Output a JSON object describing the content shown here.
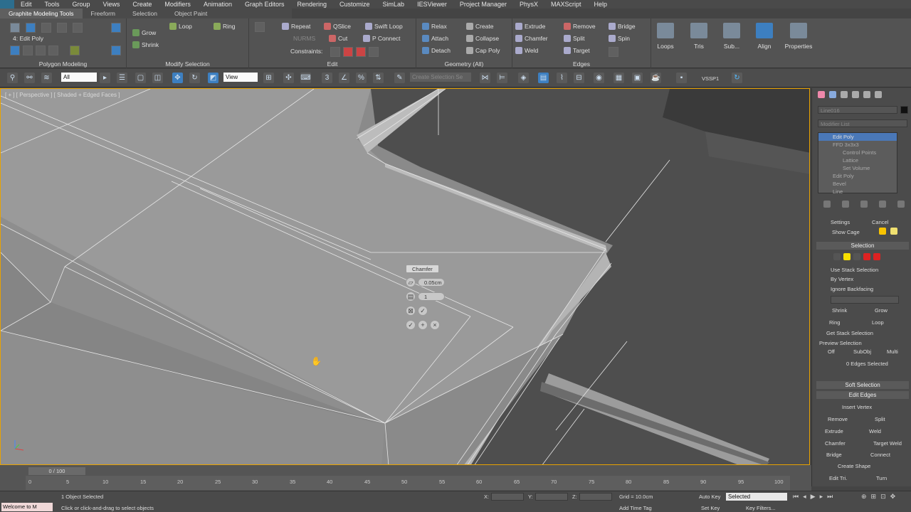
{
  "menu": [
    "Edit",
    "Tools",
    "Group",
    "Views",
    "Create",
    "Modifiers",
    "Animation",
    "Graph Editors",
    "Rendering",
    "Customize",
    "SimLab",
    "IESViewer",
    "Project Manager",
    "PhysX",
    "MAXScript",
    "Help"
  ],
  "graphite_tabs": [
    "Graphite Modeling Tools",
    "Freeform",
    "Selection",
    "Object Paint"
  ],
  "ribbon": {
    "level_label": "4: Edit Poly",
    "polygon_modeling": "Polygon Modeling",
    "grow": "Grow",
    "shrink": "Shrink",
    "loop": "Loop",
    "ring": "Ring",
    "modify_selection": "Modify Selection",
    "repeat": "Repeat",
    "nurms": "NURMS",
    "qslice": "QSlice",
    "cut": "Cut",
    "swift_loop": "Swift Loop",
    "p_connect": "P Connect",
    "constraints": "Constraints:",
    "edit": "Edit",
    "relax": "Relax",
    "attach": "Attach",
    "detach": "Detach",
    "create": "Create",
    "collapse": "Collapse",
    "cap_poly": "Cap Poly",
    "geometry_all": "Geometry (All)",
    "extrude": "Extrude",
    "chamfer": "Chamfer",
    "weld": "Weld",
    "remove": "Remove",
    "split": "Split",
    "target": "Target",
    "bridge": "Bridge",
    "spin": "Spin",
    "edges": "Edges",
    "loops": "Loops",
    "tris": "Tris",
    "subdiv": "Sub...",
    "align": "Align",
    "properties": "Properties"
  },
  "toolbar": {
    "filter": "All",
    "ref_coord": "View",
    "named_sel": "Create Selection Se",
    "vssp": "VSSP1"
  },
  "viewport": {
    "label": "[ + ] [ Perspective ] [ Shaded + Edged Faces ]"
  },
  "caddy": {
    "title": "Chamfer",
    "amount": "0.05cm",
    "segments": "1"
  },
  "command_panel": {
    "object_name": "Line016",
    "modifier_list": "Modifier List",
    "stack": [
      "Edit Poly",
      "FFD 3x3x3",
      "Control Points",
      "Lattice",
      "Set Volume",
      "Edit Poly",
      "Bevel",
      "Line"
    ],
    "settings": "Settings",
    "cancel": "Cancel",
    "show_cage": "Show Cage",
    "selection": "Selection",
    "use_stack_selection": "Use Stack Selection",
    "by_vertex": "By Vertex",
    "ignore_backfacing": "Ignore Backfacing",
    "shrink": "Shrink",
    "grow": "Grow",
    "ring": "Ring",
    "loop": "Loop",
    "get_stack_selection": "Get Stack Selection",
    "preview_selection": "Preview Selection",
    "off": "Off",
    "subobj": "SubObj",
    "multi": "Multi",
    "edges_selected": "0 Edges Selected",
    "soft_selection": "Soft Selection",
    "edit_edges": "Edit Edges",
    "insert_vertex": "Insert Vertex",
    "remove": "Remove",
    "split": "Split",
    "extrude": "Extrude",
    "weld": "Weld",
    "chamfer": "Chamfer",
    "target_weld": "Target Weld",
    "bridge": "Bridge",
    "connect": "Connect",
    "create_shape": "Create Shape",
    "edit_tri": "Edit Tri.",
    "turn": "Turn"
  },
  "timeline": {
    "slider": "0 / 100",
    "ticks": [
      "0",
      "5",
      "10",
      "15",
      "20",
      "25",
      "30",
      "35",
      "40",
      "45",
      "50",
      "55",
      "60",
      "65",
      "70",
      "75",
      "80",
      "85",
      "90",
      "95",
      "100"
    ]
  },
  "status": {
    "listener": "Welcome to M",
    "selected": "1 Object Selected",
    "prompt": "Click or click-and-drag to select objects",
    "x_label": "X:",
    "y_label": "Y:",
    "z_label": "Z:",
    "grid": "Grid = 10.0cm",
    "auto_key": "Auto Key",
    "selected_dd": "Selected",
    "set_key": "Set Key",
    "key_filters": "Key Filters...",
    "add_time_tag": "Add Time Tag"
  }
}
